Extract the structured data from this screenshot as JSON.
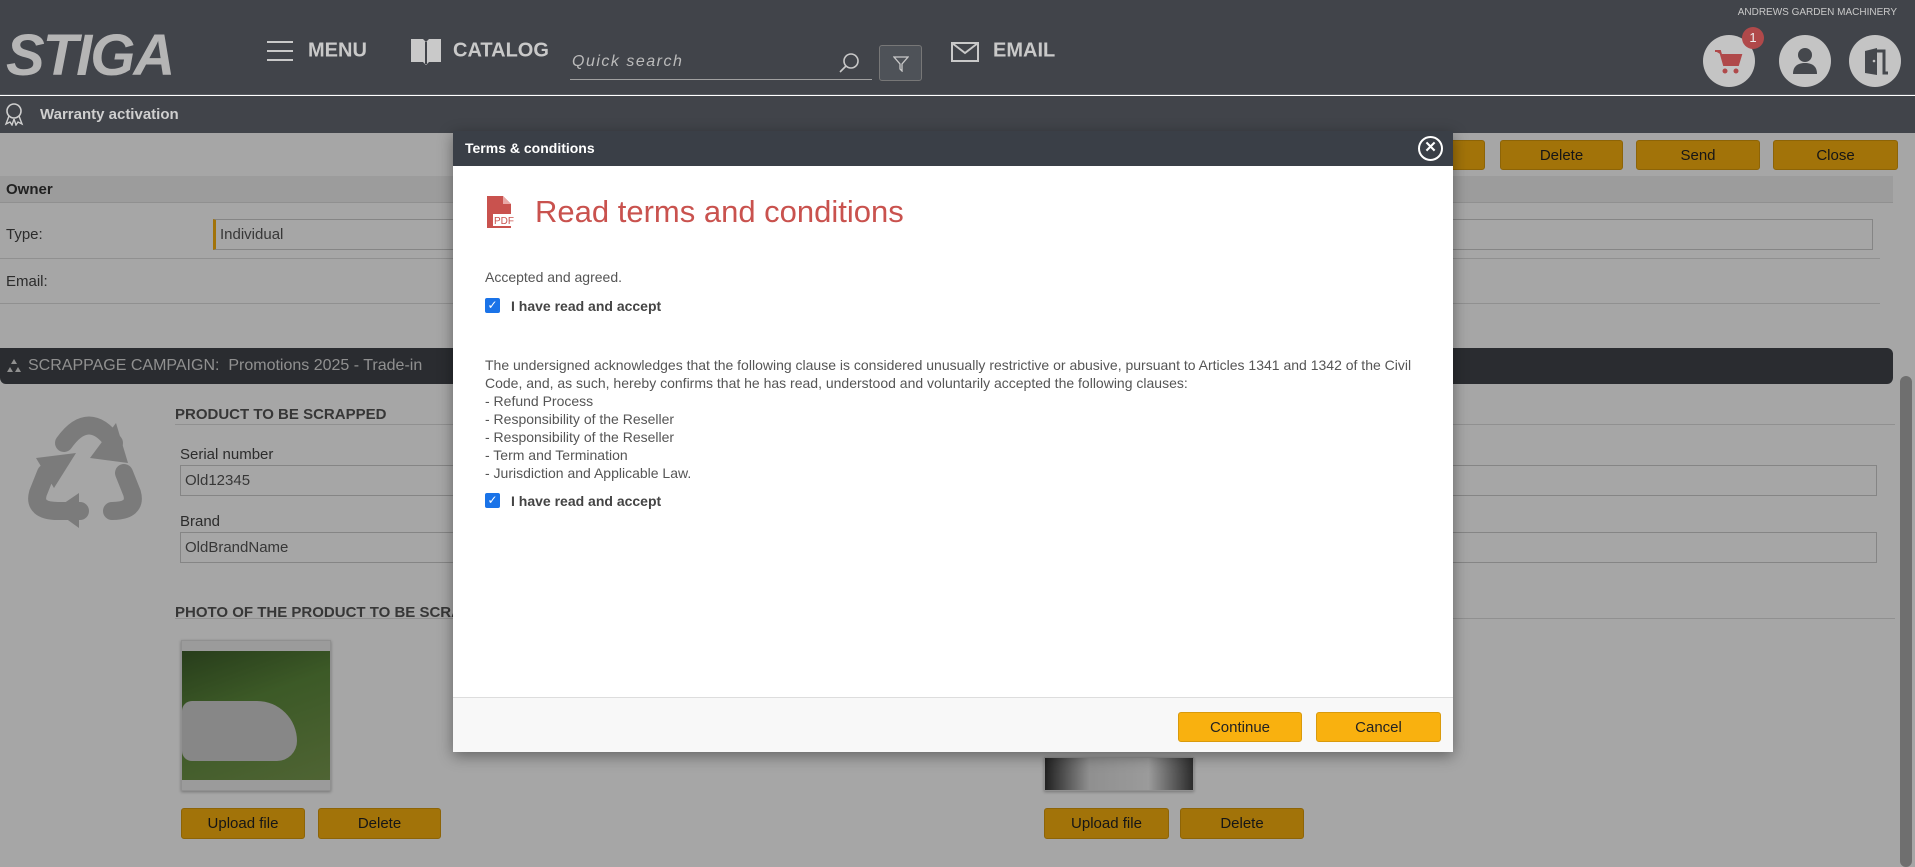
{
  "header": {
    "logo": "STIGA",
    "menu": "MENU",
    "catalog": "CATALOG",
    "search_placeholder": "Quick search",
    "email": "EMAIL",
    "company": "ANDREWS GARDEN MACHINERY",
    "cart_count": "1",
    "icons": [
      "hamburger-icon",
      "book-icon",
      "search-icon",
      "filter-icon",
      "mail-icon",
      "cart-icon",
      "user-icon",
      "exit-door-icon"
    ]
  },
  "subbar": {
    "title": "Warranty activation",
    "icon": "award-ribbon-icon"
  },
  "toolbar": {
    "delete": "Delete",
    "send": "Send",
    "close": "Close"
  },
  "owner": {
    "heading": "Owner",
    "type_label": "Type:",
    "type_value": "Individual",
    "email_label": "Email:"
  },
  "scrappage": {
    "label": "SCRAPPAGE CAMPAIGN:",
    "campaign": "Promotions 2025 - Trade-in",
    "product_heading": "PRODUCT TO BE SCRAPPED",
    "serial_label": "Serial number",
    "serial_value": "Old12345",
    "brand_label": "Brand",
    "brand_value": "OldBrandName",
    "photo_heading": "PHOTO OF THE PRODUCT TO BE SCRAP",
    "upload": "Upload file",
    "delete": "Delete"
  },
  "modal": {
    "header": "Terms & conditions",
    "title": "Read terms and conditions",
    "accepted": "Accepted and agreed.",
    "accept_label": "I have read and accept",
    "accept1_checked": true,
    "accept2_checked": true,
    "paragraph": "The undersigned acknowledges that the following clause is considered unusually restrictive or abusive, pursuant to Articles 1341 and 1342 of the Civil Code, and, as such, hereby confirms that he has read, understood and voluntarily accepted the following clauses:",
    "clauses": [
      "- Refund Process",
      "- Responsibility of the Reseller",
      "- Responsibility of the Reseller",
      "- Term and Termination",
      "- Jurisdiction and Applicable Law."
    ],
    "continue": "Continue",
    "cancel": "Cancel"
  },
  "colors": {
    "accent": "#f9b10f",
    "header": "#41444a",
    "title_red": "#c9524e",
    "checkbox": "#1a73e8",
    "badge": "#b0494a"
  }
}
